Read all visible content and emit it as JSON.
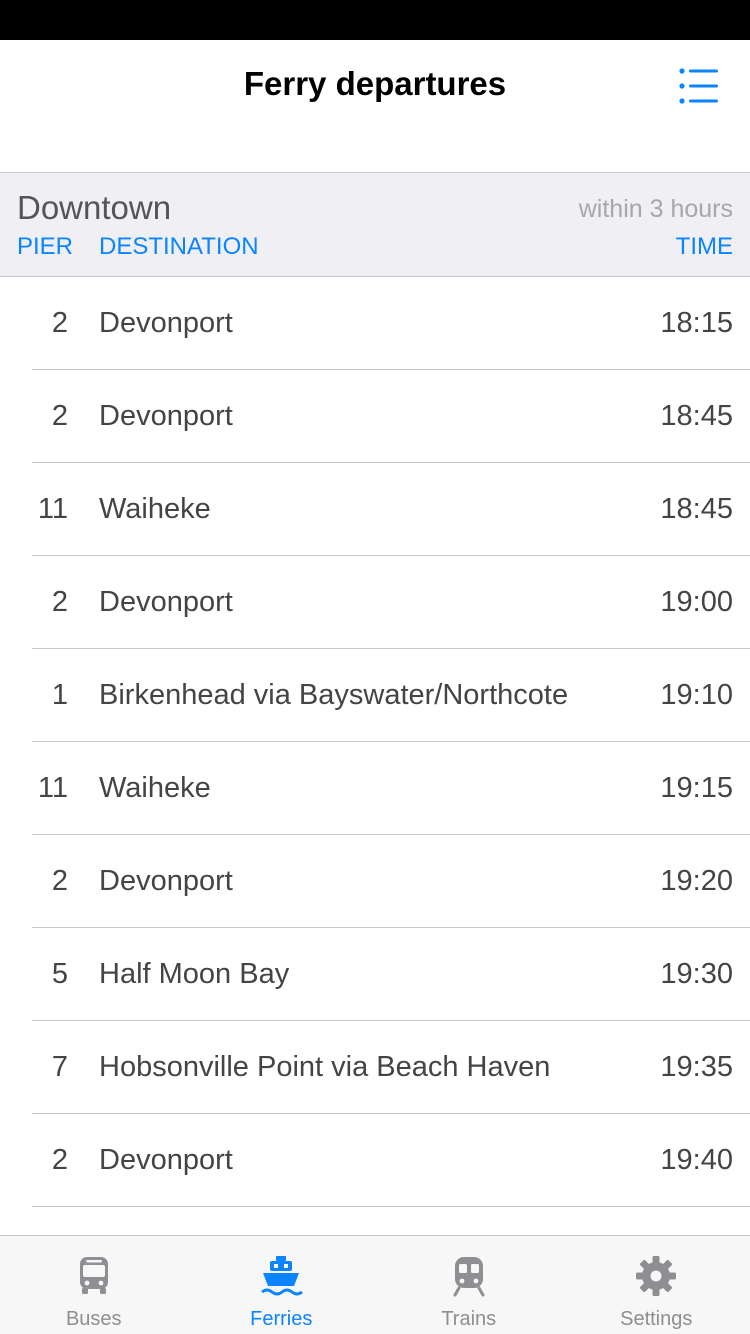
{
  "header": {
    "title": "Ferry departures",
    "menu_icon": "list-icon"
  },
  "section": {
    "station": "Downtown",
    "range": "within 3 hours",
    "columns": {
      "pier": "PIER",
      "destination": "DESTINATION",
      "time": "TIME"
    }
  },
  "departures": [
    {
      "pier": "2",
      "destination": "Devonport",
      "time": "18:15"
    },
    {
      "pier": "2",
      "destination": "Devonport",
      "time": "18:45"
    },
    {
      "pier": "11",
      "destination": "Waiheke",
      "time": "18:45"
    },
    {
      "pier": "2",
      "destination": "Devonport",
      "time": "19:00"
    },
    {
      "pier": "1",
      "destination": "Birkenhead via Bayswater/Northcote",
      "time": "19:10"
    },
    {
      "pier": "11",
      "destination": "Waiheke",
      "time": "19:15"
    },
    {
      "pier": "2",
      "destination": "Devonport",
      "time": "19:20"
    },
    {
      "pier": "5",
      "destination": "Half Moon Bay",
      "time": "19:30"
    },
    {
      "pier": "7",
      "destination": "Hobsonville Point via Beach Haven",
      "time": "19:35"
    },
    {
      "pier": "2",
      "destination": "Devonport",
      "time": "19:40"
    }
  ],
  "tabs": [
    {
      "label": "Buses",
      "icon": "bus-icon",
      "active": false
    },
    {
      "label": "Ferries",
      "icon": "ferry-icon",
      "active": true
    },
    {
      "label": "Trains",
      "icon": "train-icon",
      "active": false
    },
    {
      "label": "Settings",
      "icon": "gear-icon",
      "active": false
    }
  ],
  "colors": {
    "accent": "#0a84ff",
    "inactive": "#8e8e93",
    "section_bg": "#efeff4",
    "text": "#444444"
  }
}
